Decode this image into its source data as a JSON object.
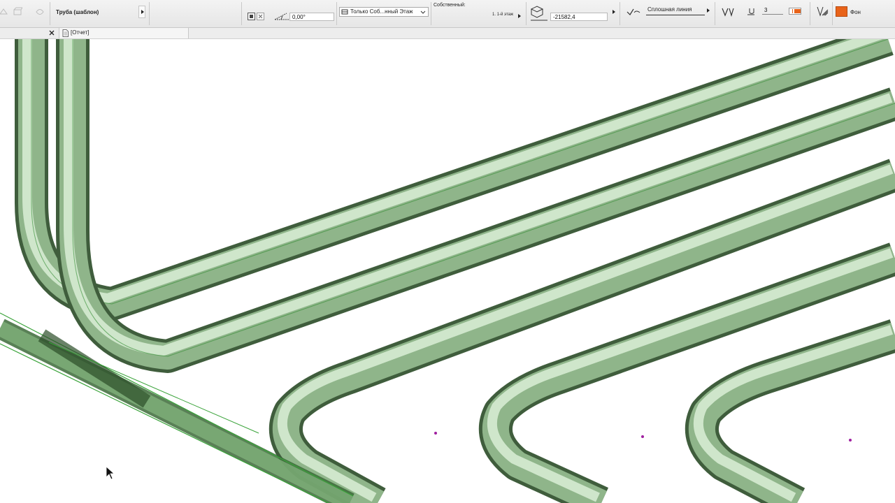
{
  "infobox": {
    "element_name": "Труба (шаблон)",
    "angle_value": "0,00°",
    "floor_filter": "Только Соб...нный Этаж",
    "own_label": "Собственный:",
    "story_label": "1. 1-й этаж",
    "elevation_value": "-21582,4",
    "line_type": "Сплошная линия",
    "pen_number": "3",
    "background_label": "Фон",
    "accent_color": "#e8631a"
  },
  "tabs": [
    {
      "label": "[Отчет]"
    }
  ],
  "icons": {
    "close": "close-icon",
    "document": "document-icon",
    "cursor": "mouse-cursor-icon"
  },
  "viewport": {
    "pipe_color": "#9fc79a",
    "pipe_edge_color": "#2f8a2f",
    "hotspot_color": "#a020a0"
  }
}
